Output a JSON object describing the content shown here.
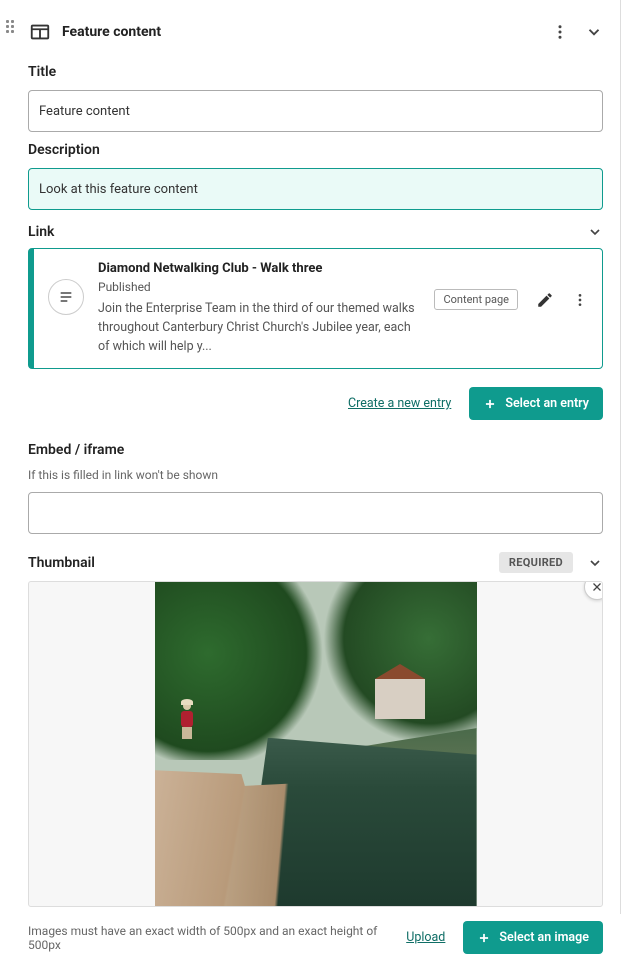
{
  "header": {
    "title": "Feature content"
  },
  "fields": {
    "title_label": "Title",
    "title_value": "Feature content",
    "description_label": "Description",
    "description_value": "Look at this feature content",
    "link_label": "Link",
    "embed_label": "Embed / iframe",
    "embed_help": "If this is filled in link won't be shown",
    "embed_value": "",
    "thumbnail_label": "Thumbnail",
    "thumbnail_required": "REQUIRED",
    "thumbnail_help": "Images must have an exact width of 500px and an exact height of 500px"
  },
  "entry": {
    "title": "Diamond Netwalking Club - Walk three",
    "status": "Published",
    "description": "Join the Enterprise Team in the third of our themed walks throughout Canterbury Christ Church's Jubilee year, each of which will help y...",
    "type_badge": "Content page"
  },
  "actions": {
    "create_entry": "Create a new entry",
    "select_entry": "Select an entry",
    "upload": "Upload",
    "select_image": "Select an image"
  }
}
